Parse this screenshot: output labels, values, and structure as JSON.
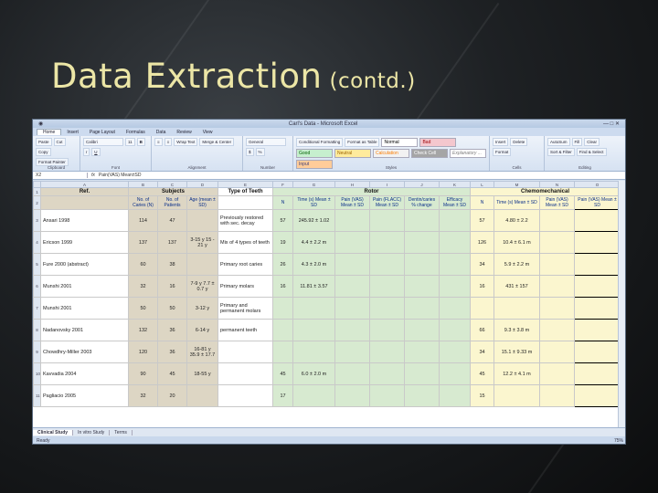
{
  "slide": {
    "title": "Data Extraction",
    "subtitle": "(contd.)"
  },
  "window": {
    "title": "Carl's Data - Microsoft Excel"
  },
  "ribbon": {
    "tabs": [
      "Home",
      "Insert",
      "Page Layout",
      "Formulas",
      "Data",
      "Review",
      "View"
    ],
    "clipboard": [
      "Cut",
      "Copy",
      "Format Painter",
      "Paste"
    ],
    "group_labels": [
      "Clipboard",
      "Font",
      "Alignment",
      "Number",
      "Styles",
      "Cells",
      "Editing"
    ],
    "font": {
      "name": "Calibri",
      "size": "11"
    },
    "alignment": [
      "Wrap Text",
      "Merge & Center"
    ],
    "number": {
      "format": "General"
    },
    "styles": [
      "Conditional Formatting",
      "Format as Table"
    ],
    "cell_styles": [
      "Normal",
      "Bad",
      "Good",
      "Neutral",
      "Calculation",
      "Check Cell",
      "Explanatory ...",
      "Input"
    ],
    "cells": [
      "Insert",
      "Delete",
      "Format"
    ],
    "editing": [
      "AutoSum",
      "Fill",
      "Clear",
      "Sort & Filter",
      "Find & Select"
    ]
  },
  "formula_bar": {
    "name_box": "X2",
    "formula": "Pain(VAS) Mean±SD"
  },
  "columns": [
    "A",
    "B",
    "C",
    "D",
    "E",
    "F",
    "G",
    "H",
    "I",
    "J",
    "K",
    "L",
    "M",
    "N",
    "O"
  ],
  "headers": {
    "group_row": {
      "ref": "Ref.",
      "subjects": "Subjects",
      "type_of_teeth": "Type of Teeth",
      "rotor": "Rotor",
      "chemo": "Chemomechanical"
    },
    "sub_row": [
      "No. of Caries (N)",
      "No. of Patients",
      "Age (mean ± SD)",
      "N",
      "Time (s) Mean ± SD",
      "Pain (VAS) Mean ± SD",
      "Pain (FLACC) Mean ± SD",
      "Dentin/caries % change",
      "Efficacy Mean ± SD",
      "N",
      "Time (s) Mean ± SD",
      "Pain (VAS) Mean ± SD",
      "Pain (VAS) Mean ± SD"
    ]
  },
  "rows": [
    {
      "ref": "Ansari 1998",
      "n_caries": "114",
      "n_patients": "47",
      "age": "",
      "teeth": "Previously restored with sec. decay",
      "rotor_n": "57",
      "rotor_time": "245.92 ± 1.02",
      "chemo_n": "57",
      "chemo_time": "4.80 ± 2.2",
      "chemo_pain": ""
    },
    {
      "ref": "Ericson 1999",
      "n_caries": "137",
      "n_patients": "137",
      "age": "3-15 y 15 - 21 y",
      "teeth": "Mix of 4 types of teeth",
      "rotor_n": "19",
      "rotor_time": "4.4 ± 2.2 m",
      "chemo_n": "126",
      "chemo_time": "10.4 ± 6.1 m",
      "chemo_pain": ""
    },
    {
      "ref": "Fure 2000 (abstract)",
      "n_caries": "60",
      "n_patients": "38",
      "age": "",
      "teeth": "Primary root caries",
      "rotor_n": "26",
      "rotor_time": "4.3 ± 2.0 m",
      "chemo_n": "34",
      "chemo_time": "5.9 ± 2.2 m",
      "chemo_pain": ""
    },
    {
      "ref": "Munshi 2001",
      "n_caries": "32",
      "n_patients": "16",
      "age": "7-9 y 7.7 ± 0.7 y",
      "teeth": "Primary molars",
      "rotor_n": "16",
      "rotor_time": "11.81 ± 3.57",
      "chemo_n": "16",
      "chemo_time": "431 ± 157",
      "chemo_pain": ""
    },
    {
      "ref": "Munshi 2001",
      "n_caries": "50",
      "n_patients": "50",
      "age": "3-12 y",
      "teeth": "Primary and permanent molars",
      "rotor_n": "",
      "rotor_time": "",
      "chemo_n": "",
      "chemo_time": "",
      "chemo_pain": ""
    },
    {
      "ref": "Nadanovsky 2001",
      "n_caries": "132",
      "n_patients": "36",
      "age": "6-14 y",
      "teeth": "permanent teeth",
      "rotor_n": "",
      "rotor_time": "",
      "chemo_n": "66",
      "chemo_time": "9.3 ± 3.8 m",
      "chemo_pain": ""
    },
    {
      "ref": "Chowdhry-Miller 2003",
      "n_caries": "120",
      "n_patients": "36",
      "age": "16-81 y 35.9 ± 17.7",
      "teeth": "",
      "rotor_n": "",
      "rotor_time": "",
      "chemo_n": "34",
      "chemo_time": "15.1 ± 9.33 m",
      "chemo_pain": ""
    },
    {
      "ref": "Kavvadia 2004",
      "n_caries": "90",
      "n_patients": "45",
      "age": "18-55 y",
      "teeth": "",
      "rotor_n": "45",
      "rotor_time": "6.0 ± 2.0 m",
      "chemo_n": "45",
      "chemo_time": "12.2 ± 4.1 m",
      "chemo_pain": ""
    },
    {
      "ref": "Pagliacio 2005",
      "n_caries": "32",
      "n_patients": "20",
      "age": "",
      "teeth": "",
      "rotor_n": "17",
      "rotor_time": "",
      "chemo_n": "15",
      "chemo_time": "",
      "chemo_pain": ""
    }
  ],
  "sheet_tabs": [
    "Clinical Study",
    "In vitro Study",
    "Terms"
  ],
  "status": {
    "left": "Ready",
    "zoom": "75%"
  }
}
